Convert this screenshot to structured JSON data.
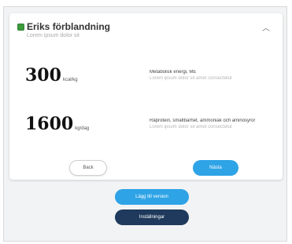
{
  "card": {
    "title": "Eriks förblandning",
    "subtitle": "Lorem ipsum dolor sit",
    "collapse_icon": "chevron-up-icon",
    "status_color": "#3c9b3c"
  },
  "rows": [
    {
      "value": "300",
      "unit": "kcal/kg",
      "label": "Metabolisk energi, ME",
      "note": "Lorem ipsum dolor sit amet consectetur"
    },
    {
      "value": "1600",
      "unit": "kg/dag",
      "label": "Råprotein, smältbarhet, ammoniak och aminosyror",
      "note": "Lorem ipsum dolor sit amet consectetur"
    }
  ],
  "buttons": {
    "back": "Back",
    "next": "Nästa",
    "add_version": "Lägg till version",
    "settings": "Inställningar"
  },
  "colors": {
    "accent": "#2ea3e6",
    "dark": "#1f3a5c"
  }
}
